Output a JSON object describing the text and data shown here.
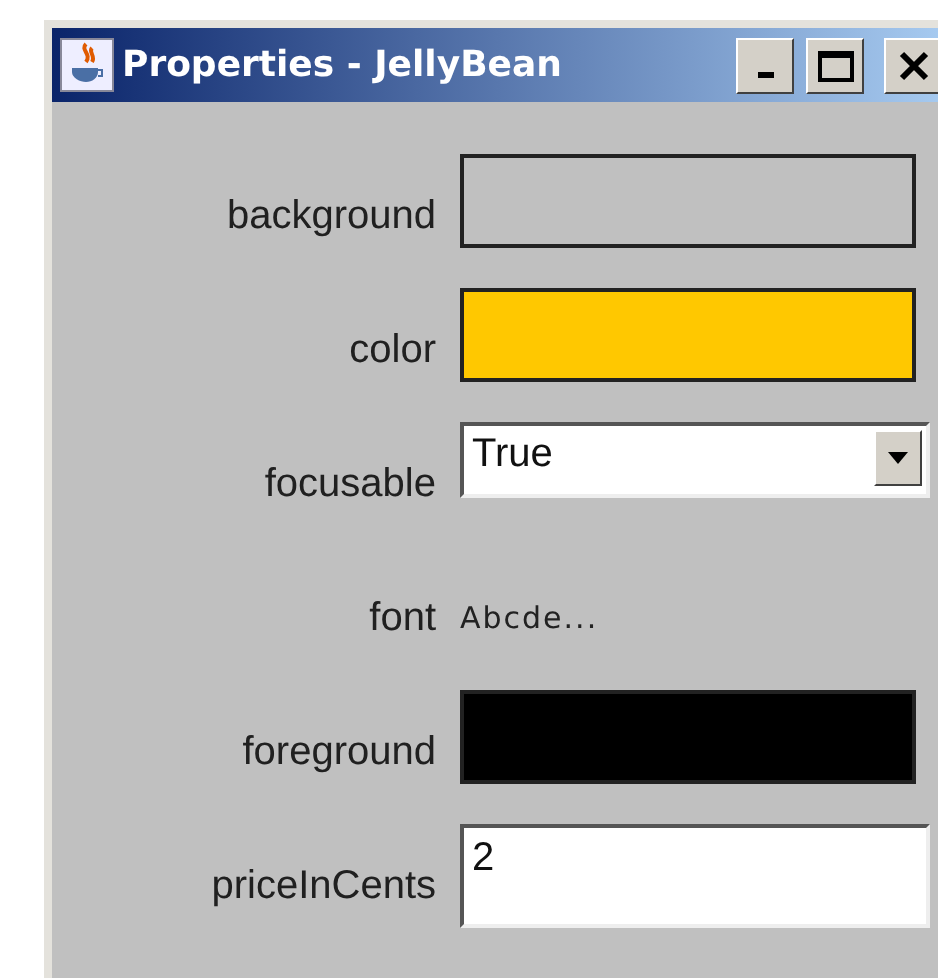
{
  "window": {
    "title": "Properties - JellyBean"
  },
  "rows": [
    {
      "label": "background",
      "kind": "color",
      "color": "#c0c0c0"
    },
    {
      "label": "color",
      "kind": "color",
      "color": "#ffc800"
    },
    {
      "label": "focusable",
      "kind": "choice",
      "value": "True"
    },
    {
      "label": "font",
      "kind": "text",
      "value": "Abcde..."
    },
    {
      "label": "foreground",
      "kind": "color",
      "color": "#000000"
    },
    {
      "label": "priceInCents",
      "kind": "input",
      "value": "2"
    }
  ]
}
